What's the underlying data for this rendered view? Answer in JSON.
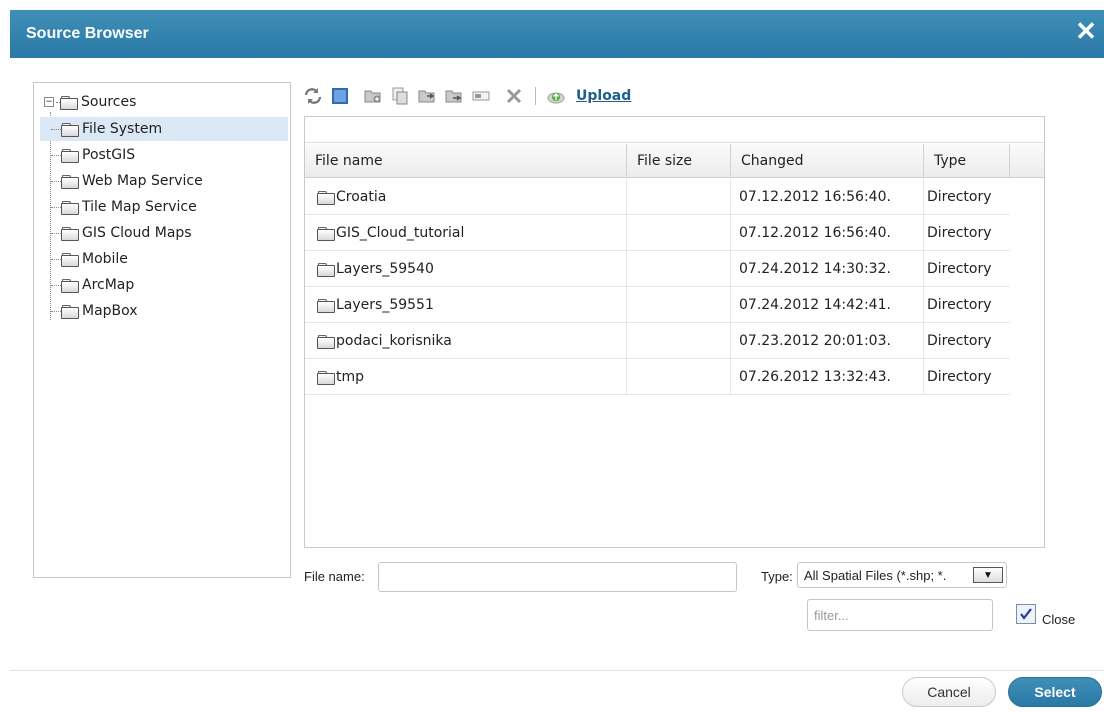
{
  "window": {
    "title": "Source Browser",
    "close_glyph": "✕"
  },
  "tree": {
    "root": {
      "label": "Sources",
      "expander": "−",
      "icon": "folder-open-icon"
    },
    "items": [
      {
        "label": "File System",
        "selected": true,
        "icon": "folder-icon"
      },
      {
        "label": "PostGIS",
        "icon": "folder-icon"
      },
      {
        "label": "Web Map Service",
        "icon": "folder-icon"
      },
      {
        "label": "Tile Map Service",
        "icon": "folder-icon"
      },
      {
        "label": "GIS Cloud Maps",
        "icon": "folder-icon"
      },
      {
        "label": "Mobile",
        "icon": "folder-icon"
      },
      {
        "label": "ArcMap",
        "icon": "folder-icon"
      },
      {
        "label": "MapBox",
        "icon": "folder-icon"
      }
    ]
  },
  "toolbar": {
    "icons": [
      "refresh-icon",
      "view-mode-icon",
      "new-folder-icon",
      "copy-icon",
      "paste-icon",
      "move-icon",
      "rename-icon",
      "delete-icon"
    ],
    "upload_label": "Upload",
    "upload_icon": "cloud-upload-icon"
  },
  "grid": {
    "columns": [
      "File name",
      "File size",
      "Changed",
      "Type"
    ],
    "rows": [
      {
        "name": "Croatia",
        "size": "",
        "changed": "07.12.2012 16:56:40.",
        "type": "Directory"
      },
      {
        "name": "GIS_Cloud_tutorial",
        "size": "",
        "changed": "07.12.2012 16:56:40.",
        "type": "Directory"
      },
      {
        "name": "Layers_59540",
        "size": "",
        "changed": "07.24.2012 14:30:32.",
        "type": "Directory"
      },
      {
        "name": "Layers_59551",
        "size": "",
        "changed": "07.24.2012 14:42:41.",
        "type": "Directory"
      },
      {
        "name": "podaci_korisnika",
        "size": "",
        "changed": "07.23.2012 20:01:03.",
        "type": "Directory"
      },
      {
        "name": "tmp",
        "size": "",
        "changed": "07.26.2012 13:32:43.",
        "type": "Directory"
      }
    ]
  },
  "form": {
    "file_name_label": "File name:",
    "file_name_value": "",
    "type_label": "Type:",
    "type_value": "All Spatial Files (*.shp; *.",
    "filter_placeholder": "filter...",
    "close_label": "Close",
    "close_checked": true
  },
  "footer": {
    "cancel_label": "Cancel",
    "select_label": "Select"
  },
  "colors": {
    "accent": "#2f82ad",
    "link": "#1f5f8b",
    "selection": "#dbe8f6"
  }
}
